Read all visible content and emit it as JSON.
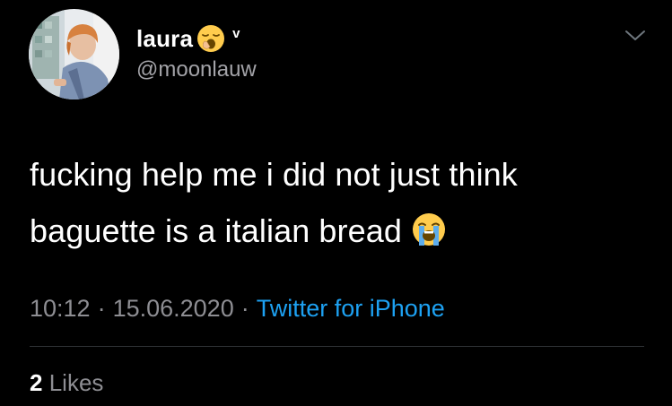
{
  "user": {
    "display_name": "laura",
    "name_emoji": "yawning-face",
    "verified_mark": "v",
    "handle": "@moonlauw"
  },
  "tweet": {
    "text_lines": [
      "fucking help me i did not just think",
      "baguette is a italian bread"
    ],
    "trailing_emoji": "loudly-crying-face"
  },
  "meta": {
    "time": "10:12",
    "date": "15.06.2020",
    "separator": "·",
    "source": "Twitter for iPhone"
  },
  "stats": {
    "likes_count": "2",
    "likes_label": "Likes"
  },
  "colors": {
    "background": "#000000",
    "text": "#ffffff",
    "secondary_text": "#8e8e93",
    "link": "#1da1f2",
    "divider": "#2f3336"
  },
  "icons": {
    "options": "chevron-down-icon"
  }
}
